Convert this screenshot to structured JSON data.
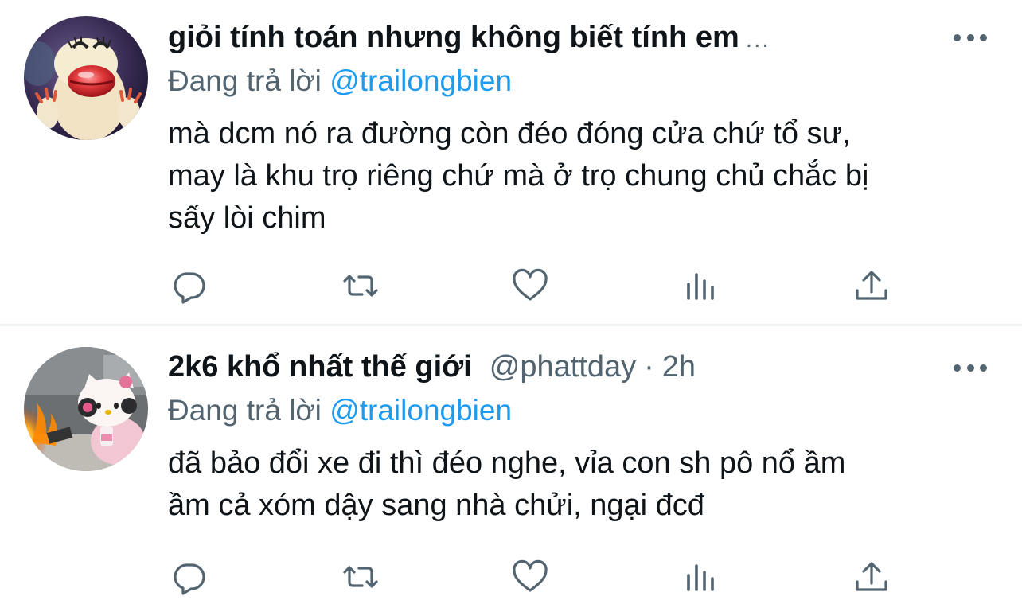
{
  "tweets": [
    {
      "display_name": "giỏi tính toán nhưng không biết tính em",
      "truncation": "...",
      "reply_prefix": "Đang trả lời",
      "reply_to": "@trailongbien",
      "text_lines": [
        "mà dcm nó ra đường còn đéo đóng cửa chứ tổ sư,",
        "may là khu trọ riêng chứ mà ở trọ chung chủ chắc bị",
        "sấy lòi chim"
      ]
    },
    {
      "display_name": "2k6 khổ nhất thế giới",
      "handle": "@phattday",
      "separator": "·",
      "time": "2h",
      "reply_prefix": "Đang trả lời",
      "reply_to": "@trailongbien",
      "text_lines": [
        "đã bảo đổi xe đi thì đéo nghe, vỉa con sh pô nổ ầm",
        "ầm cả xóm dậy sang nhà chửi, ngại đcđ"
      ]
    }
  ],
  "icons": {
    "more": "more-horizontal-icon",
    "reply": "reply-bubble-icon",
    "retweet": "retweet-icon",
    "like": "heart-icon",
    "views": "views-bar-chart-icon",
    "share": "share-upload-icon"
  },
  "colors": {
    "text": "#0f1419",
    "secondary": "#536471",
    "link": "#1d9bf0",
    "divider": "#eff3f4"
  }
}
